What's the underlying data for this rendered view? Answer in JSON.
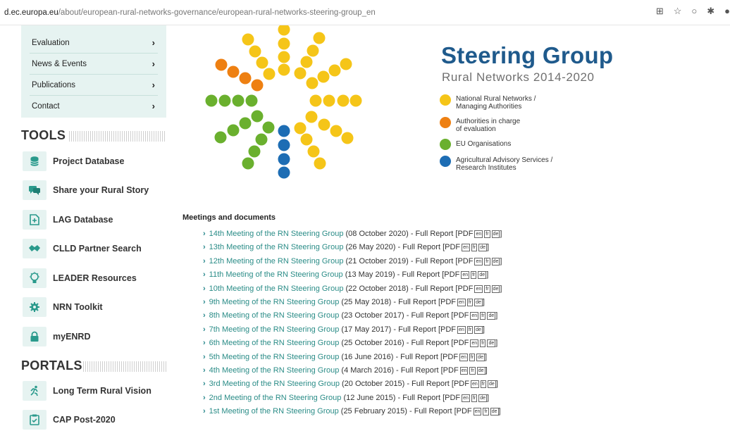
{
  "browser": {
    "url_domain": "d.ec.europa.eu",
    "url_path": "/about/european-rural-networks-governance/european-rural-networks-steering-group_en"
  },
  "sidebar": {
    "menu": [
      {
        "label": "Evaluation",
        "icon": "chevron-right-icon"
      },
      {
        "label": "News & Events",
        "icon": "chevron-right-icon"
      },
      {
        "label": "Publications",
        "icon": "chevron-right-icon"
      },
      {
        "label": "Contact",
        "icon": "chevron-right-icon"
      }
    ],
    "tools_heading": "TOOLS",
    "tools": [
      {
        "label": "Project Database",
        "icon": "database-icon"
      },
      {
        "label": "Share your Rural Story",
        "icon": "chat-icon"
      },
      {
        "label": "LAG Database",
        "icon": "document-icon"
      },
      {
        "label": "CLLD Partner Search",
        "icon": "handshake-icon"
      },
      {
        "label": "LEADER Resources",
        "icon": "lightbulb-icon"
      },
      {
        "label": "NRN Toolkit",
        "icon": "gear-icon"
      },
      {
        "label": "myENRD",
        "icon": "lock-icon"
      }
    ],
    "portals_heading": "PORTALS",
    "portals": [
      {
        "label": "Long Term Rural Vision",
        "icon": "runner-icon"
      },
      {
        "label": "CAP Post-2020",
        "icon": "clipboard-icon"
      }
    ]
  },
  "steering": {
    "title": "Steering Group",
    "subtitle": "Rural Networks 2014-2020",
    "colors": {
      "yellow": "#f5c518",
      "orange": "#ee8012",
      "green": "#6ab02e",
      "blue": "#1d6db4"
    },
    "legend": [
      {
        "label": "National Rural Networks /\nManaging Authorities",
        "color": "#f5c518"
      },
      {
        "label": "Authorities in charge\nof evaluation",
        "color": "#ee8012"
      },
      {
        "label": "EU Organisations",
        "color": "#6ab02e"
      },
      {
        "label": "Agricultural Advisory Services /\nResearch Institutes",
        "color": "#1d6db4"
      }
    ]
  },
  "meetings": {
    "heading": "Meetings and documents",
    "langs": [
      "en",
      "fr",
      "de"
    ],
    "items": [
      {
        "link": "14th Meeting of the RN Steering Group",
        "rest": " (08 October 2020) - Full Report [PDF"
      },
      {
        "link": "13th Meeting of the RN Steering Group",
        "rest": " (26 May 2020) - Full Report [PDF"
      },
      {
        "link": "12th Meeting of the RN Steering Group",
        "rest": " (21 October 2019) - Full Report [PDF"
      },
      {
        "link": "11th Meeting of the RN Steering Group",
        "rest": " (13 May 2019) - Full Report [PDF"
      },
      {
        "link": "10th Meeting of the RN Steering Group",
        "rest": " (22 October 2018) - Full Report [PDF"
      },
      {
        "link": "9th Meeting of the RN Steering Group",
        "rest": " (25 May 2018) - Full Report [PDF"
      },
      {
        "link": "8th Meeting of the RN Steering Group",
        "rest": " (23 October 2017) - Full Report [PDF"
      },
      {
        "link": "7th Meeting of the RN Steering Group",
        "rest": " (17 May 2017) - Full Report [PDF"
      },
      {
        "link": "6th Meeting of the RN Steering Group",
        "rest": " (25 October 2016) - Full Report [PDF"
      },
      {
        "link": "5th Meeting of the RN Steering Group",
        "rest": " (16 June 2016) - Full Report [PDF"
      },
      {
        "link": "4th Meeting of the RN Steering Group",
        "rest": " (4 March 2016) - Full Report [PDF"
      },
      {
        "link": "3rd Meeting of the RN Steering Group",
        "rest": " (20 October 2015) - Full Report  [PDF"
      },
      {
        "link": "2nd Meeting of the RN Steering Group",
        "rest": " (12 June 2015) - Full Report [PDF"
      },
      {
        "link": "1st Meeting of the RN Steering Group",
        "rest": " (25 February 2015) - Full Report [PDF"
      }
    ]
  }
}
